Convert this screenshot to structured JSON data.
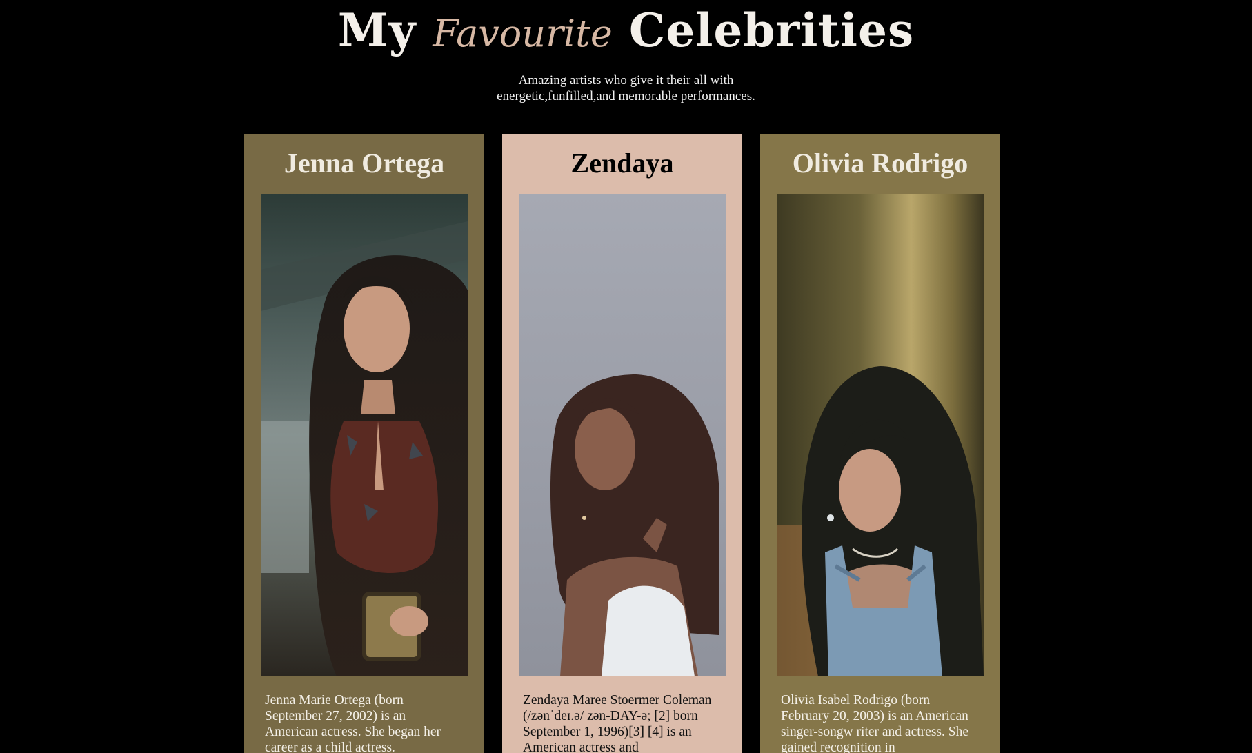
{
  "header": {
    "title_start": "My",
    "title_script": "Favourite",
    "title_end": "Celebrities",
    "subtitle": "Amazing artists who give it their all with energetic,funfilled,and memorable performances."
  },
  "cards": [
    {
      "name": "Jenna Ortega",
      "bio": "Jenna Marie Ortega (born September 27, 2002) is an American actress. She began her career as a child actress.",
      "background_color": "#786a45"
    },
    {
      "name": "Zendaya",
      "bio": "Zendaya Maree Stoermer Coleman (/zənˈdeɪ.ə/ zən-DAY-ə; [2] born September 1, 1996)[3] [4] is an American actress and",
      "background_color": "#dcbcab"
    },
    {
      "name": "Olivia Rodrigo",
      "bio": "Olivia Isabel Rodrigo (born February 20, 2003) is an American singer-songw riter and actress. She gained recognition in",
      "background_color": "#857649"
    }
  ]
}
